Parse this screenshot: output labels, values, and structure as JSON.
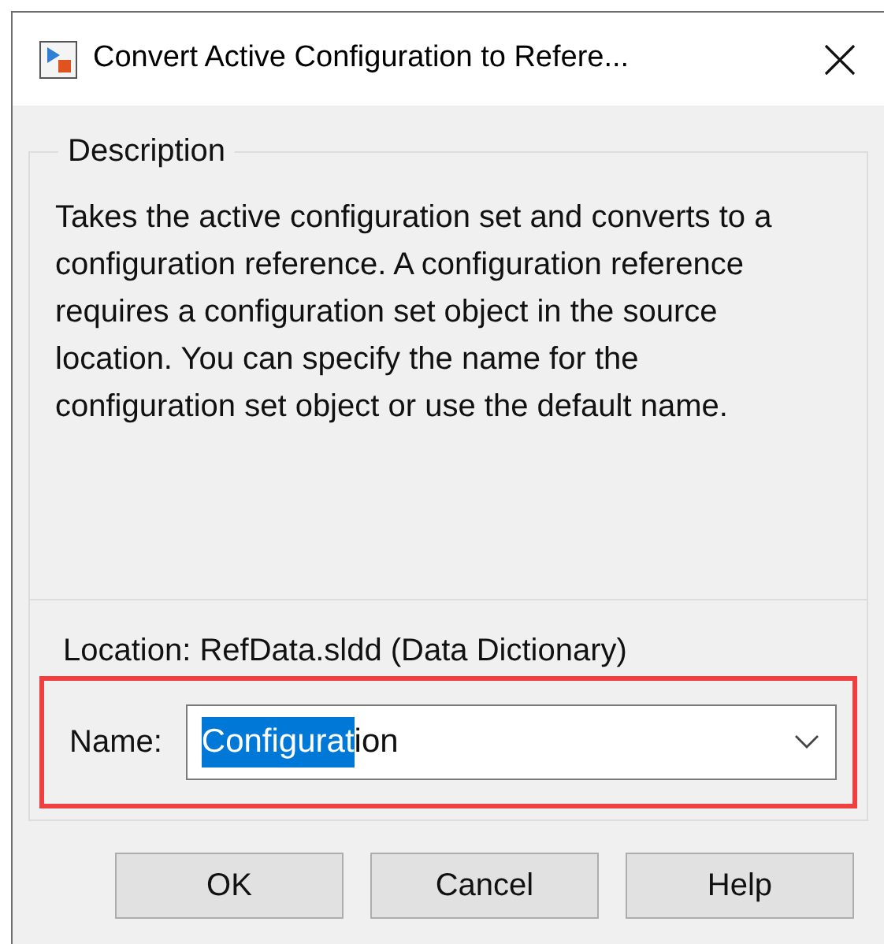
{
  "window": {
    "title": "Convert Active Configuration to Refere..."
  },
  "description": {
    "legend": "Description",
    "text": "Takes the active configuration set and converts to a configuration reference. A configuration reference requires a configuration set object in the source location. You can specify the name for the configuration set object or use the default name."
  },
  "location": {
    "label": "Location: RefData.sldd (Data Dictionary)"
  },
  "name_field": {
    "label": "Name:",
    "selected_text": "Configurat",
    "unselected_text": "ion",
    "highlighted": true
  },
  "buttons": [
    "OK",
    "Cancel",
    "Help"
  ]
}
